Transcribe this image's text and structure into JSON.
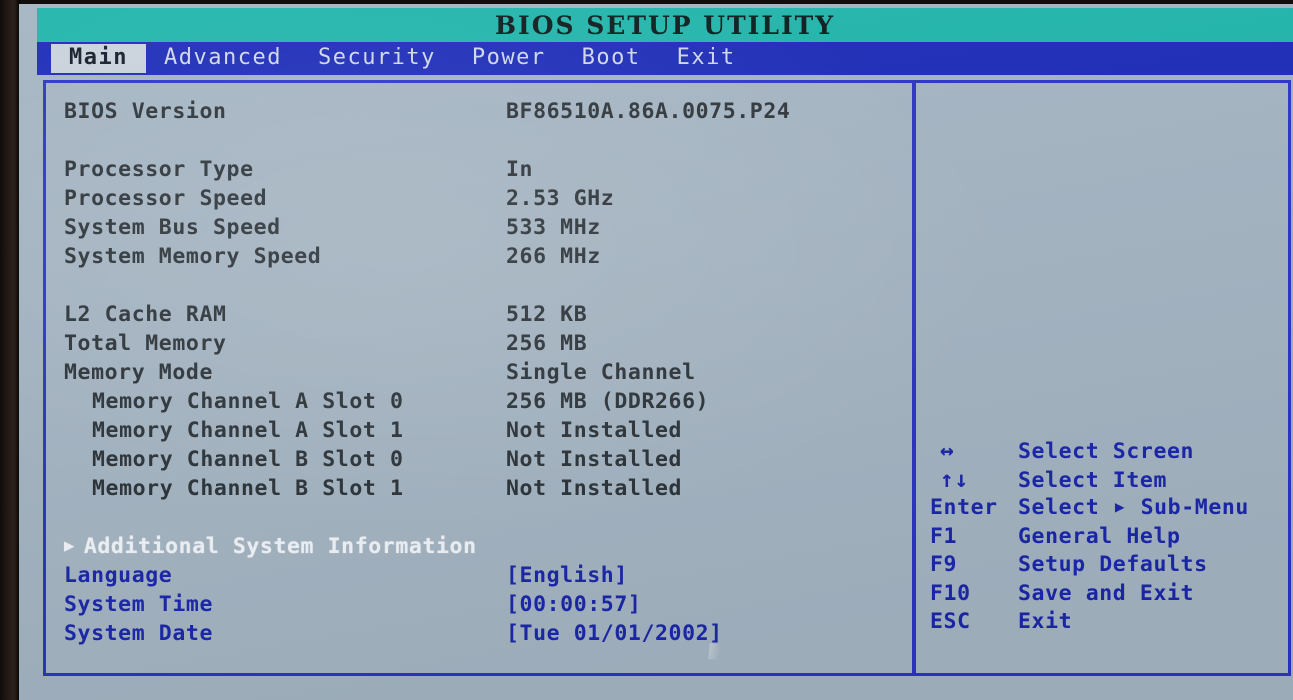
{
  "window": {
    "title": "BIOS SETUP UTILITY",
    "title_bar_color": "#1fb5ab",
    "menu_bar_color": "#1b2ab8",
    "screen_background": "#a3b4c2",
    "frame_border_color": "#2b34c4",
    "setting_text_color": "#1b27ab",
    "info_text_color": "#2a3238",
    "selected_text_color": "#f2f6fb"
  },
  "menu": {
    "items": [
      {
        "label": "Main",
        "active": true
      },
      {
        "label": "Advanced",
        "active": false
      },
      {
        "label": "Security",
        "active": false
      },
      {
        "label": "Power",
        "active": false
      },
      {
        "label": "Boot",
        "active": false
      },
      {
        "label": "Exit",
        "active": false
      }
    ]
  },
  "main": {
    "system_info": [
      {
        "label": "BIOS Version",
        "value": "BF86510A.86A.0075.P24"
      }
    ],
    "processor_info": [
      {
        "label": "Processor Type",
        "value": "In"
      },
      {
        "label": "Processor Speed",
        "value": "2.53 GHz"
      },
      {
        "label": "System Bus Speed",
        "value": "533 MHz"
      },
      {
        "label": "System Memory Speed",
        "value": "266 MHz"
      }
    ],
    "memory_info": [
      {
        "label": "L2 Cache RAM",
        "value": "512 KB",
        "indent": false
      },
      {
        "label": "Total Memory",
        "value": "256 MB",
        "indent": false
      },
      {
        "label": "Memory Mode",
        "value": "Single Channel",
        "indent": false
      },
      {
        "label": "Memory Channel A Slot 0",
        "value": "256 MB (DDR266)",
        "indent": true
      },
      {
        "label": "Memory Channel A Slot 1",
        "value": "Not Installed",
        "indent": true
      },
      {
        "label": "Memory Channel B Slot 0",
        "value": "Not Installed",
        "indent": true
      },
      {
        "label": "Memory Channel B Slot 1",
        "value": "Not Installed",
        "indent": true
      }
    ],
    "submenu": {
      "arrow_icon": "▶",
      "label": "Additional System Information",
      "selected": true
    },
    "settings": [
      {
        "label": "Language",
        "value": "[English]"
      },
      {
        "label": "System Time",
        "value": "[00:00:57]"
      },
      {
        "label": "System Date",
        "value": "[Tue 01/01/2002]"
      }
    ]
  },
  "help": {
    "keys": [
      {
        "key": "↔",
        "symbol": true,
        "desc": "Select Screen"
      },
      {
        "key": "↑↓",
        "symbol": true,
        "desc": "Select Item"
      },
      {
        "key": "Enter",
        "symbol": false,
        "desc_before": "Select",
        "desc_arrow": "▶",
        "desc_after": "Sub-Menu"
      },
      {
        "key": "F1",
        "symbol": false,
        "desc": "General Help"
      },
      {
        "key": "F9",
        "symbol": false,
        "desc": "Setup Defaults"
      },
      {
        "key": "F10",
        "symbol": false,
        "desc": "Save and Exit"
      },
      {
        "key": "ESC",
        "symbol": false,
        "desc": "Exit"
      }
    ]
  }
}
